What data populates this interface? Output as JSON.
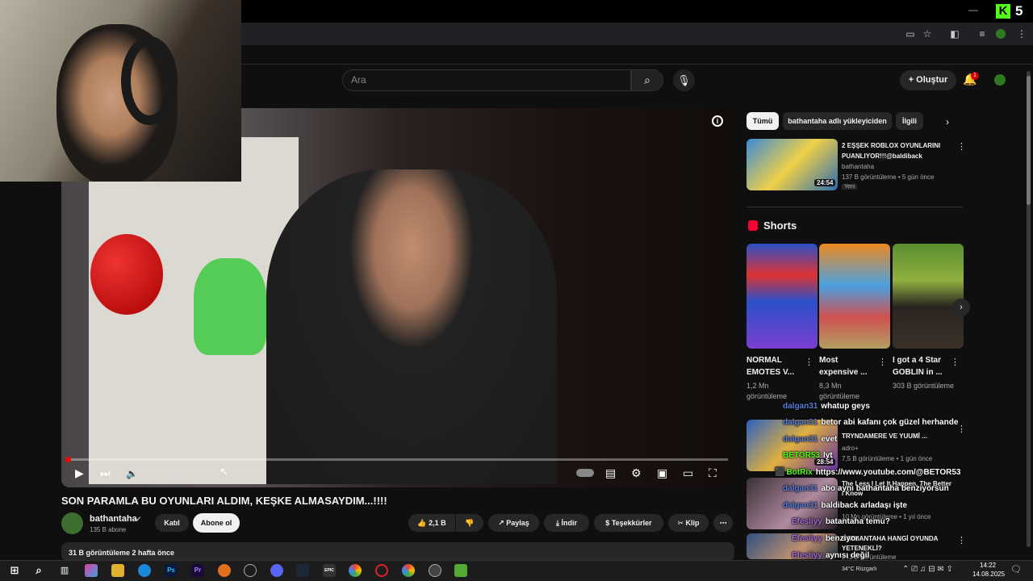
{
  "browser": {
    "kick_logo": "K",
    "kick_count": "5",
    "minimize": "—",
    "icons": [
      "cast-icon",
      "star-icon",
      "extensions-icon",
      "media-icon",
      "profile-icon",
      "menu-icon"
    ]
  },
  "header": {
    "search_placeholder": "Ara",
    "create_label": "Oluştur",
    "bell_badge": "1"
  },
  "player": {
    "time": "0:00 / 18:00",
    "info": "i"
  },
  "webcam": {},
  "video": {
    "title": "SON PARAMLA BU OYUNLARI ALDIM, KEŞKE ALMASAYDIM...!!!!",
    "channel": "bathantaha",
    "subscribers": "135 B abone",
    "join_label": "Katıl",
    "subscribe_label": "Abone ol",
    "likes": "2,1 B",
    "share_label": "Paylaş",
    "download_label": "İndir",
    "thanks_label": "Teşekkürler",
    "clip_label": "Klip",
    "views_date": "31 B görüntüleme  2 hafta önce"
  },
  "sidebar": {
    "chips": [
      "Tümü",
      "bathantaha adlı yükleyiciden",
      "İlgili"
    ],
    "recommended": {
      "title": "2 EŞŞEK ROBLOX OYUNLARINI PUANLIYOR!!!@baldiback",
      "channel": "bathantaha",
      "meta": "137 B görüntüleme • 5 gün önce",
      "badge": "Yeni",
      "duration": "24:54"
    },
    "shorts_title": "Shorts",
    "shorts": [
      {
        "title": "NORMAL EMOTES V...",
        "views": "1,2 Mn görüntüleme"
      },
      {
        "title": "Most expensive ...",
        "views": "8,3 Mn görüntüleme"
      },
      {
        "title": "I got a 4 Star GOBLIN in ...",
        "views": "303 B görüntüleme"
      }
    ],
    "list": [
      {
        "title": "TRYNDAMERE VE YUUMİ ...",
        "meta1": "adro+",
        "meta2": "7,5 B görüntüleme • 1 gün önce",
        "duration": "28:54"
      },
      {
        "title": "The Less I Let It Happen, The Better I Know",
        "meta1": "10 Mn görüntüleme • 1 yıl önce"
      },
      {
        "title": "BATHANTAHA HANGİ OYUNDA YETENEKLİ?",
        "meta1": "241 B görüntüleme"
      }
    ]
  },
  "chat": [
    {
      "user": "dalgan31",
      "msg": "whatup geys",
      "color": "#5b7cd6"
    },
    {
      "user": "dalgan31",
      "msg": "betor abi kafanı çok güzel herhande",
      "color": "#5b7cd6"
    },
    {
      "user": "dalgan31",
      "msg": "evet",
      "color": "#5b7cd6"
    },
    {
      "user": "BETOR53",
      "msg": "lyt",
      "color": "#53fc18"
    },
    {
      "user": "BotRix",
      "msg": "https://www.youtube.com/@BETOR53",
      "color": "#53fc18"
    },
    {
      "user": "dalgan31",
      "msg": "abo aynı bathantaha benziyorsun",
      "color": "#5b7cd6"
    },
    {
      "user": "dalgan31",
      "msg": "baldiback arladaşı işte",
      "color": "#5b7cd6"
    },
    {
      "user": "Efesliyy",
      "msg": "batantaha temu?",
      "color": "#a36ad6"
    },
    {
      "user": "Efesliyy",
      "msg": "benziyor",
      "color": "#a36ad6"
    },
    {
      "user": "Efesliyy",
      "msg": "aynısı değil",
      "color": "#a36ad6"
    },
    {
      "user": "Efesliyy",
      "msg": "ama andırıyo",
      "color": "#a36ad6"
    }
  ],
  "taskbar": {
    "apps": [
      "Ps",
      "Pr",
      "EPIC"
    ],
    "weather": "34°C Rüzgarlı",
    "time": "14:22",
    "date": "14.08.2025"
  }
}
